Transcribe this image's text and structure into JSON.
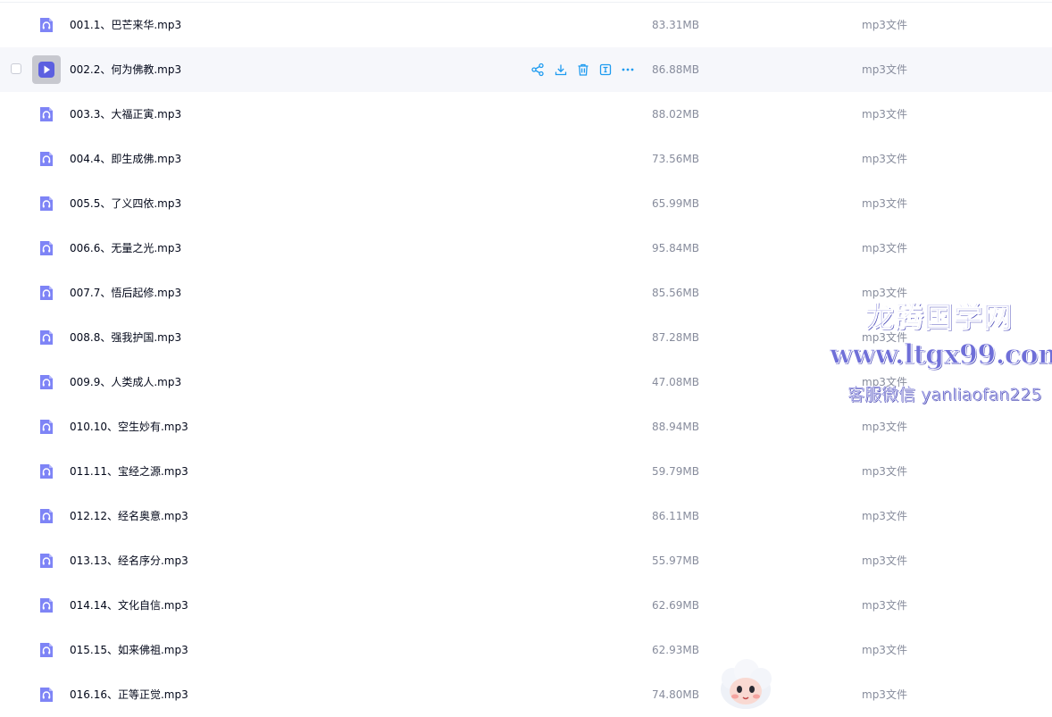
{
  "colors": {
    "accent": "#1e9bf0",
    "icon_purple": "#7e84f6",
    "hover_row": "#f6f7fb",
    "muted_text": "#878c9c",
    "watermark": "#6f6fd8"
  },
  "files": [
    {
      "name": "001.1、巴芒来华.mp3",
      "size": "83.31MB",
      "type": "mp3文件"
    },
    {
      "name": "002.2、何为佛教.mp3",
      "size": "86.88MB",
      "type": "mp3文件"
    },
    {
      "name": "003.3、大福正寅.mp3",
      "size": "88.02MB",
      "type": "mp3文件"
    },
    {
      "name": "004.4、即生成佛.mp3",
      "size": "73.56MB",
      "type": "mp3文件"
    },
    {
      "name": "005.5、了义四依.mp3",
      "size": "65.99MB",
      "type": "mp3文件"
    },
    {
      "name": "006.6、无量之光.mp3",
      "size": "95.84MB",
      "type": "mp3文件"
    },
    {
      "name": "007.7、悟后起修.mp3",
      "size": "85.56MB",
      "type": "mp3文件"
    },
    {
      "name": "008.8、强我护国.mp3",
      "size": "87.28MB",
      "type": "mp3文件"
    },
    {
      "name": "009.9、人类成人.mp3",
      "size": "47.08MB",
      "type": "mp3文件"
    },
    {
      "name": "010.10、空生妙有.mp3",
      "size": "88.94MB",
      "type": "mp3文件"
    },
    {
      "name": "011.11、宝经之源.mp3",
      "size": "59.79MB",
      "type": "mp3文件"
    },
    {
      "name": "012.12、经名奥意.mp3",
      "size": "86.11MB",
      "type": "mp3文件"
    },
    {
      "name": "013.13、经名序分.mp3",
      "size": "55.97MB",
      "type": "mp3文件"
    },
    {
      "name": "014.14、文化自信.mp3",
      "size": "62.69MB",
      "type": "mp3文件"
    },
    {
      "name": "015.15、如来佛祖.mp3",
      "size": "62.93MB",
      "type": "mp3文件"
    },
    {
      "name": "016.16、正等正觉.mp3",
      "size": "74.80MB",
      "type": "mp3文件"
    }
  ],
  "hovered_row": 1,
  "row_actions": [
    {
      "icon": "share-icon"
    },
    {
      "icon": "download-icon"
    },
    {
      "icon": "delete-icon"
    },
    {
      "icon": "rename-icon"
    },
    {
      "icon": "more-icon"
    }
  ],
  "watermark": {
    "title": "龙腾国学网",
    "url": "www.ltgx99.com",
    "contact": "客服微信 yanliaofan225"
  },
  "assistant_mascot": {
    "icon": "cloud-mascot-icon"
  }
}
